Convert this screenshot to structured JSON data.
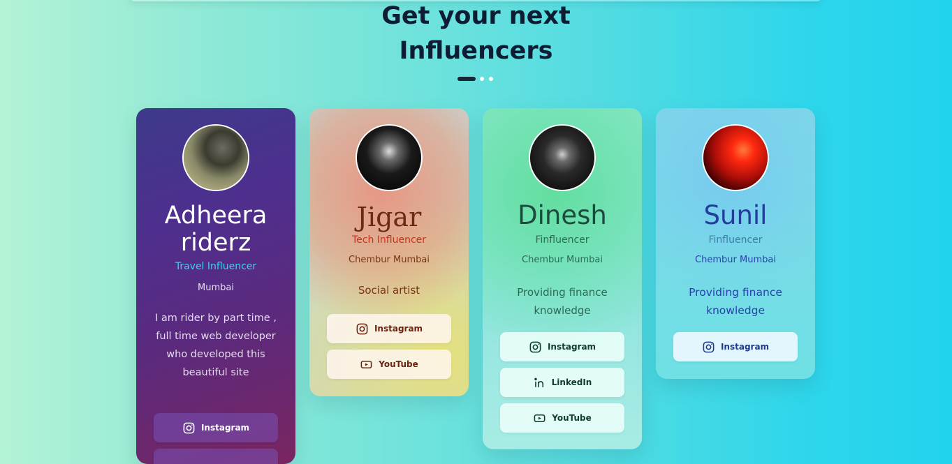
{
  "heading": {
    "line1": "Get your next",
    "line2": "Influencers"
  },
  "carousel": {
    "active_index": 0,
    "dots": 3
  },
  "cards": [
    {
      "name": "Adheera riderz",
      "role": "Travel Influencer",
      "location": "Mumbai",
      "bio": "I am rider by part time , full time web developer who developed this beautiful site",
      "buttons": [
        {
          "label": "Instagram",
          "icon": "instagram-icon"
        }
      ]
    },
    {
      "name": "Jigar",
      "role": "Tech Influencer",
      "location": "Chembur Mumbai",
      "bio": "Social artist",
      "buttons": [
        {
          "label": "Instagram",
          "icon": "instagram-icon"
        },
        {
          "label": "YouTube",
          "icon": "youtube-icon"
        }
      ]
    },
    {
      "name": "Dinesh",
      "role": "Finfluencer",
      "location": "Chembur Mumbai",
      "bio": "Providing finance knowledge",
      "buttons": [
        {
          "label": "Instagram",
          "icon": "instagram-icon"
        },
        {
          "label": "LinkedIn",
          "icon": "linkedin-icon"
        },
        {
          "label": "YouTube",
          "icon": "youtube-icon"
        }
      ]
    },
    {
      "name": "Sunil",
      "role": "Finfluencer",
      "location": "Chembur Mumbai",
      "bio": "Providing finance knowledge",
      "buttons": [
        {
          "label": "Instagram",
          "icon": "instagram-icon"
        }
      ]
    }
  ]
}
